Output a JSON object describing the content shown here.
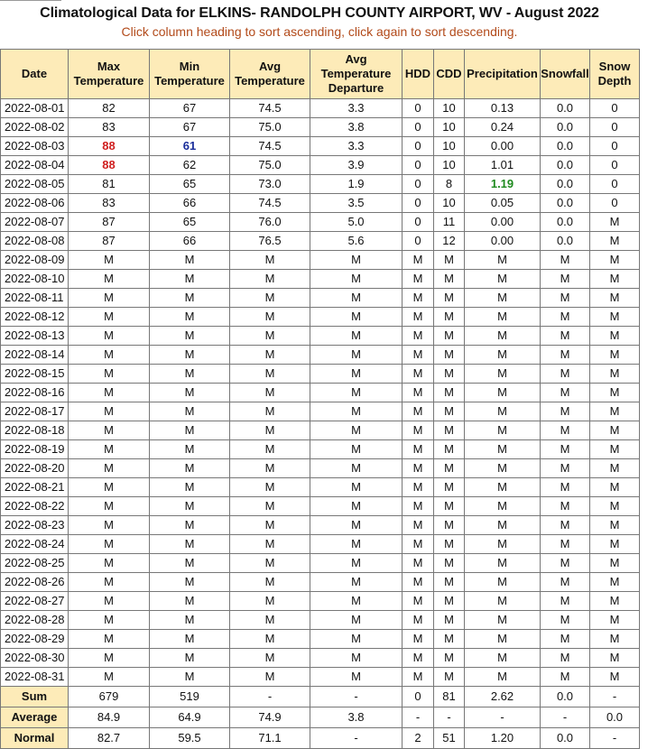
{
  "title": "Climatological Data for ELKINS- RANDOLPH COUNTY AIRPORT, WV - August 2022",
  "subtitle": "Click column heading to sort ascending, click again to sort descending.",
  "columns": [
    "Date",
    "Max Temperature",
    "Min Temperature",
    "Avg Temperature",
    "Avg Temperature Departure",
    "HDD",
    "CDD",
    "Precipitation",
    "Snowfall",
    "Snow Depth"
  ],
  "rows": [
    [
      "2022-08-01",
      "82",
      "67",
      "74.5",
      "3.3",
      "0",
      "10",
      "0.13",
      "0.0",
      "0"
    ],
    [
      "2022-08-02",
      "83",
      "67",
      "75.0",
      "3.8",
      "0",
      "10",
      "0.24",
      "0.0",
      "0"
    ],
    [
      "2022-08-03",
      "88",
      "61",
      "74.5",
      "3.3",
      "0",
      "10",
      "0.00",
      "0.0",
      "0"
    ],
    [
      "2022-08-04",
      "88",
      "62",
      "75.0",
      "3.9",
      "0",
      "10",
      "1.01",
      "0.0",
      "0"
    ],
    [
      "2022-08-05",
      "81",
      "65",
      "73.0",
      "1.9",
      "0",
      "8",
      "1.19",
      "0.0",
      "0"
    ],
    [
      "2022-08-06",
      "83",
      "66",
      "74.5",
      "3.5",
      "0",
      "10",
      "0.05",
      "0.0",
      "0"
    ],
    [
      "2022-08-07",
      "87",
      "65",
      "76.0",
      "5.0",
      "0",
      "11",
      "0.00",
      "0.0",
      "M"
    ],
    [
      "2022-08-08",
      "87",
      "66",
      "76.5",
      "5.6",
      "0",
      "12",
      "0.00",
      "0.0",
      "M"
    ],
    [
      "2022-08-09",
      "M",
      "M",
      "M",
      "M",
      "M",
      "M",
      "M",
      "M",
      "M"
    ],
    [
      "2022-08-10",
      "M",
      "M",
      "M",
      "M",
      "M",
      "M",
      "M",
      "M",
      "M"
    ],
    [
      "2022-08-11",
      "M",
      "M",
      "M",
      "M",
      "M",
      "M",
      "M",
      "M",
      "M"
    ],
    [
      "2022-08-12",
      "M",
      "M",
      "M",
      "M",
      "M",
      "M",
      "M",
      "M",
      "M"
    ],
    [
      "2022-08-13",
      "M",
      "M",
      "M",
      "M",
      "M",
      "M",
      "M",
      "M",
      "M"
    ],
    [
      "2022-08-14",
      "M",
      "M",
      "M",
      "M",
      "M",
      "M",
      "M",
      "M",
      "M"
    ],
    [
      "2022-08-15",
      "M",
      "M",
      "M",
      "M",
      "M",
      "M",
      "M",
      "M",
      "M"
    ],
    [
      "2022-08-16",
      "M",
      "M",
      "M",
      "M",
      "M",
      "M",
      "M",
      "M",
      "M"
    ],
    [
      "2022-08-17",
      "M",
      "M",
      "M",
      "M",
      "M",
      "M",
      "M",
      "M",
      "M"
    ],
    [
      "2022-08-18",
      "M",
      "M",
      "M",
      "M",
      "M",
      "M",
      "M",
      "M",
      "M"
    ],
    [
      "2022-08-19",
      "M",
      "M",
      "M",
      "M",
      "M",
      "M",
      "M",
      "M",
      "M"
    ],
    [
      "2022-08-20",
      "M",
      "M",
      "M",
      "M",
      "M",
      "M",
      "M",
      "M",
      "M"
    ],
    [
      "2022-08-21",
      "M",
      "M",
      "M",
      "M",
      "M",
      "M",
      "M",
      "M",
      "M"
    ],
    [
      "2022-08-22",
      "M",
      "M",
      "M",
      "M",
      "M",
      "M",
      "M",
      "M",
      "M"
    ],
    [
      "2022-08-23",
      "M",
      "M",
      "M",
      "M",
      "M",
      "M",
      "M",
      "M",
      "M"
    ],
    [
      "2022-08-24",
      "M",
      "M",
      "M",
      "M",
      "M",
      "M",
      "M",
      "M",
      "M"
    ],
    [
      "2022-08-25",
      "M",
      "M",
      "M",
      "M",
      "M",
      "M",
      "M",
      "M",
      "M"
    ],
    [
      "2022-08-26",
      "M",
      "M",
      "M",
      "M",
      "M",
      "M",
      "M",
      "M",
      "M"
    ],
    [
      "2022-08-27",
      "M",
      "M",
      "M",
      "M",
      "M",
      "M",
      "M",
      "M",
      "M"
    ],
    [
      "2022-08-28",
      "M",
      "M",
      "M",
      "M",
      "M",
      "M",
      "M",
      "M",
      "M"
    ],
    [
      "2022-08-29",
      "M",
      "M",
      "M",
      "M",
      "M",
      "M",
      "M",
      "M",
      "M"
    ],
    [
      "2022-08-30",
      "M",
      "M",
      "M",
      "M",
      "M",
      "M",
      "M",
      "M",
      "M"
    ],
    [
      "2022-08-31",
      "M",
      "M",
      "M",
      "M",
      "M",
      "M",
      "M",
      "M",
      "M"
    ]
  ],
  "highlights": [
    {
      "row": 2,
      "col": 1,
      "style": "hi"
    },
    {
      "row": 3,
      "col": 1,
      "style": "hi"
    },
    {
      "row": 2,
      "col": 2,
      "style": "lo"
    },
    {
      "row": 4,
      "col": 7,
      "style": "pr"
    }
  ],
  "summary": [
    [
      "Sum",
      "679",
      "519",
      "-",
      "-",
      "0",
      "81",
      "2.62",
      "0.0",
      "-"
    ],
    [
      "Average",
      "84.9",
      "64.9",
      "74.9",
      "3.8",
      "-",
      "-",
      "-",
      "-",
      "0.0"
    ],
    [
      "Normal",
      "82.7",
      "59.5",
      "71.1",
      "-",
      "2",
      "51",
      "1.20",
      "0.0",
      "-"
    ]
  ],
  "colors": {
    "header_bg": "#fdebb8",
    "subtitle": "#b24a1a",
    "record_high": "#d02020",
    "record_low": "#1a2e9a",
    "max_precip": "#1e8a1e"
  }
}
